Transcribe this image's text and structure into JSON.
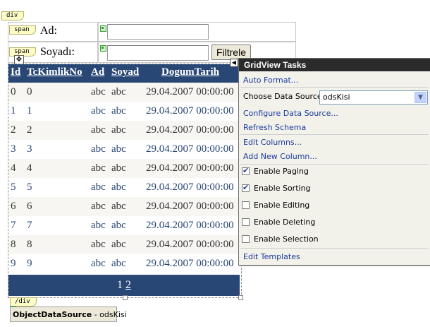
{
  "tags": {
    "div_open": "div",
    "div_close": "/div",
    "span": "span"
  },
  "form": {
    "ad_label": "Ad:",
    "soyadi_label": "Soyadı:",
    "ad_value": "",
    "soyadi_value": "",
    "filter_button": "Filtrele"
  },
  "grid": {
    "headers": [
      "Id",
      "TcKimlikNo",
      "Ad",
      "Soyad",
      "DogumTarih"
    ],
    "rows": [
      [
        "0",
        "0",
        "abc",
        "abc",
        "29.04.2007 00:00:00"
      ],
      [
        "1",
        "1",
        "abc",
        "abc",
        "29.04.2007 00:00:00"
      ],
      [
        "2",
        "2",
        "abc",
        "abc",
        "29.04.2007 00:00:00"
      ],
      [
        "3",
        "3",
        "abc",
        "abc",
        "29.04.2007 00:00:00"
      ],
      [
        "4",
        "4",
        "abc",
        "abc",
        "29.04.2007 00:00:00"
      ],
      [
        "5",
        "5",
        "abc",
        "abc",
        "29.04.2007 00:00:00"
      ],
      [
        "6",
        "6",
        "abc",
        "abc",
        "29.04.2007 00:00:00"
      ],
      [
        "7",
        "7",
        "abc",
        "abc",
        "29.04.2007 00:00:00"
      ],
      [
        "8",
        "8",
        "abc",
        "abc",
        "29.04.2007 00:00:00"
      ],
      [
        "9",
        "9",
        "abc",
        "abc",
        "29.04.2007 00:00:00"
      ]
    ],
    "pager": {
      "page1": "1",
      "page2": "2"
    },
    "colors": {
      "header": "#284775",
      "odd_row": "#f7f6f3",
      "odd_text": "#333333",
      "even_text": "#284775"
    }
  },
  "tasks": {
    "title": "GridView Tasks",
    "auto_format": "Auto Format...",
    "choose_source_label": "Choose Data Source:",
    "choose_source_value": "odsKisi",
    "configure": "Configure Data Source...",
    "refresh": "Refresh Schema",
    "edit_columns": "Edit Columns...",
    "add_column": "Add New Column...",
    "options": [
      {
        "label": "Enable Paging",
        "checked": true
      },
      {
        "label": "Enable Sorting",
        "checked": true
      },
      {
        "label": "Enable Editing",
        "checked": false
      },
      {
        "label": "Enable Deleting",
        "checked": false
      },
      {
        "label": "Enable Selection",
        "checked": false
      }
    ],
    "edit_templates": "Edit Templates"
  },
  "ods": {
    "type": "ObjectDataSource",
    "separator": " - ",
    "id": "odsKisi"
  }
}
